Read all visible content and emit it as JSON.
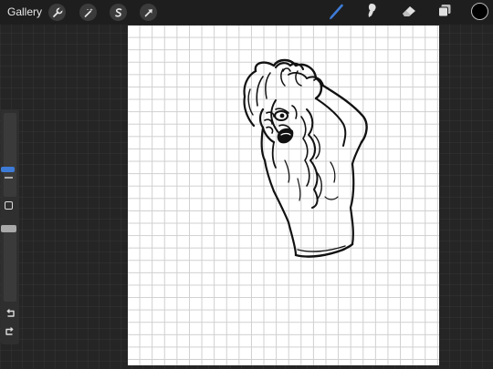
{
  "topbar": {
    "gallery_label": "Gallery",
    "left_tools": [
      {
        "icon": "wrench-icon"
      },
      {
        "icon": "magic-wand-icon"
      },
      {
        "icon": "selection-icon"
      },
      {
        "icon": "transform-arrow-icon"
      }
    ],
    "right_tools": [
      {
        "icon": "brush-icon",
        "active": true
      },
      {
        "icon": "smudge-icon"
      },
      {
        "icon": "eraser-icon"
      },
      {
        "icon": "layers-icon"
      }
    ],
    "current_color": "#000000",
    "active_tool_color": "#3d7bd6"
  },
  "sidebar": {
    "controls": [
      "brush-size-slider",
      "modify-button",
      "opacity-slider",
      "undo-button",
      "redo-button"
    ]
  },
  "canvas": {
    "background": "#ffffff",
    "grid_color": "#cfcfcf",
    "stroke_color": "#111111"
  }
}
